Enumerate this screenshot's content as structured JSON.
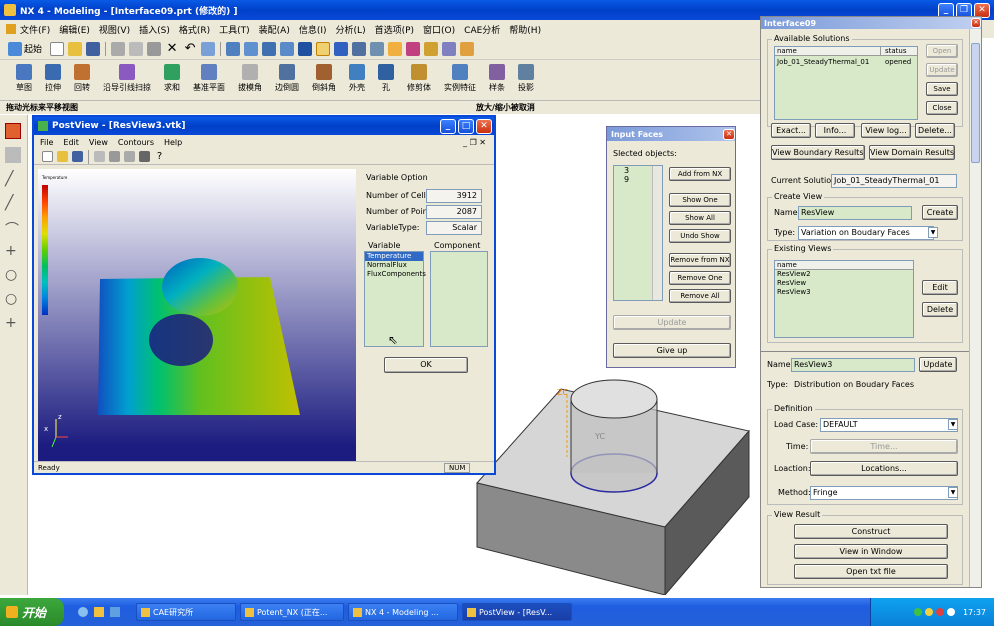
{
  "nx": {
    "title": "NX 4 - Modeling - [Interface09.prt (修改的) ]",
    "menu": [
      "文件(F)",
      "编辑(E)",
      "视图(V)",
      "插入(S)",
      "格式(R)",
      "工具(T)",
      "装配(A)",
      "信息(I)",
      "分析(L)",
      "首选项(P)",
      "窗口(O)",
      "CAE分析",
      "帮助(H)"
    ],
    "start_label": "起始",
    "ribbon": [
      "草图",
      "拉伸",
      "回转",
      "沿导引线扫掠",
      "求和",
      "基准平面",
      "拔模角",
      "边倒圆",
      "倒斜角",
      "外壳",
      "孔",
      "修剪体",
      "实例特征",
      "样条",
      "投影"
    ],
    "status_left": "拖动光标来平移视图",
    "status_mid": "放大/缩小被取消",
    "zc_label": "ZC",
    "yc_label": "YC"
  },
  "postview": {
    "title": "PostView - [ResView3.vtk]",
    "menu": [
      "File",
      "Edit",
      "View",
      "Contours",
      "Help"
    ],
    "legend_title": "Temperature",
    "variable_option": "Variable Option",
    "cells_label": "Number of Cells:",
    "cells_value": "3912",
    "points_label": "Number of Points:",
    "points_value": "2087",
    "vartype_label": "VariableType:",
    "vartype_value": "Scalar",
    "variable_group": "Variable",
    "component_group": "Component",
    "variables": [
      "Temperature",
      "NormalFlux",
      "FluxComponents"
    ],
    "ok": "OK",
    "status": "Ready",
    "num": "NUM",
    "axis_z": "z",
    "axis_x": "x"
  },
  "input_faces": {
    "title": "Input Faces",
    "selected_label": "Slected objects:",
    "items": [
      "3",
      "9"
    ],
    "buttons": [
      "Add from NX",
      "Show One",
      "Show All",
      "Undo Show",
      "Remove from NX",
      "Remove One",
      "Remove All"
    ],
    "update": "Update",
    "give_up": "Give up"
  },
  "interface": {
    "title": "Interface09",
    "available_solutions": "Available Solutions",
    "col_name": "name",
    "col_status": "status",
    "solution_name": "Job_01_SteadyThermal_01",
    "solution_status": "opened",
    "side_buttons": [
      "Open",
      "Update",
      "Save",
      "Close"
    ],
    "row_buttons": [
      "Exact...",
      "Info...",
      "View log...",
      "Delete..."
    ],
    "view_boundary": "View Boundary Results...",
    "view_domain": "View Domain Results...",
    "current_solution_label": "Current Solution:",
    "current_solution": "Job_01_SteadyThermal_01",
    "create_view": "Create View",
    "name_label": "Name:",
    "name_value": "ResView",
    "create": "Create",
    "type_label": "Type:",
    "type_value": "Variation on Boudary Faces",
    "existing_views": "Existing Views",
    "ev_col": "name",
    "views": [
      "ResView2",
      "ResView",
      "ResView3"
    ],
    "edit": "Edit",
    "delete": "Delete",
    "name2_value": "ResView3",
    "update": "Update",
    "type2_value": "Distribution on Boudary Faces",
    "definition": "Definition",
    "load_case_label": "Load Case:",
    "load_case": "DEFAULT",
    "time_label": "Time:",
    "time_btn": "Time...",
    "location_label": "Loaction:",
    "locations_btn": "Locations...",
    "method_label": "Method:",
    "method": "Fringe",
    "view_result": "View Result",
    "construct": "Construct",
    "view_in_window": "View in Window",
    "open_txt": "Open txt file"
  },
  "taskbar": {
    "start": "开始",
    "tasks": [
      "CAE研究所",
      "Potent_NX (正在...",
      "NX 4 - Modeling ...",
      "PostView - [ResV..."
    ],
    "clock": "17:37"
  },
  "colors": {
    "xp_blue": "#0a5ae6",
    "face_bg": "#ece9d8",
    "green_field": "#d7e9c9"
  }
}
